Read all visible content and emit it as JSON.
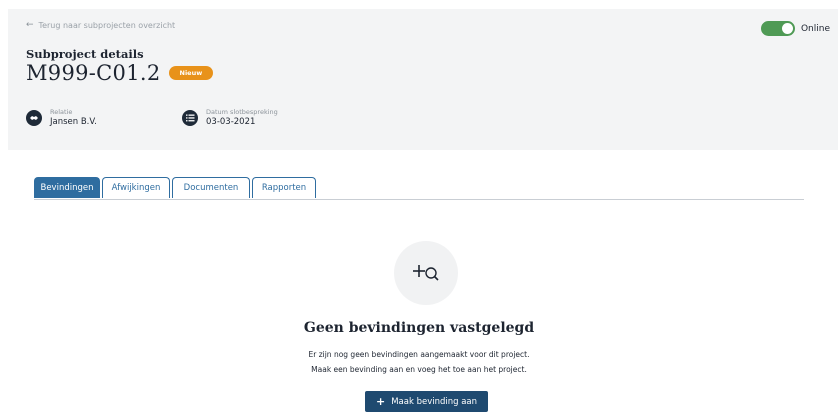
{
  "header": {
    "back_link": "Terug naar subprojecten overzicht",
    "status": {
      "label": "Online",
      "on": true,
      "color": "#4f9a55"
    },
    "subtitle": "Subproject details",
    "title": "M999-C01.2",
    "badge": {
      "label": "Nieuw",
      "color": "#e8921a"
    },
    "meta": [
      {
        "label": "Relatie",
        "value": "Jansen B.V.",
        "icon": "handshake-icon"
      },
      {
        "label": "Datum slotbespreking",
        "value": "03-03-2021",
        "icon": "list-icon"
      }
    ]
  },
  "tabs": [
    {
      "label": "Bevindingen",
      "active": true
    },
    {
      "label": "Afwijkingen",
      "active": false
    },
    {
      "label": "Documenten",
      "active": false
    },
    {
      "label": "Rapporten",
      "active": false
    }
  ],
  "empty_state": {
    "icon": "add-search-icon",
    "title": "Geen bevindingen vastgelegd",
    "line1": "Er zijn nog geen bevindingen aangemaakt voor dit project.",
    "line2": "Maak een bevinding aan en voeg het toe aan het project.",
    "button_label": "Maak bevinding aan"
  },
  "colors": {
    "accent": "#2f6da0",
    "dark_button": "#1f4a70",
    "header_bg": "#f3f4f5"
  }
}
